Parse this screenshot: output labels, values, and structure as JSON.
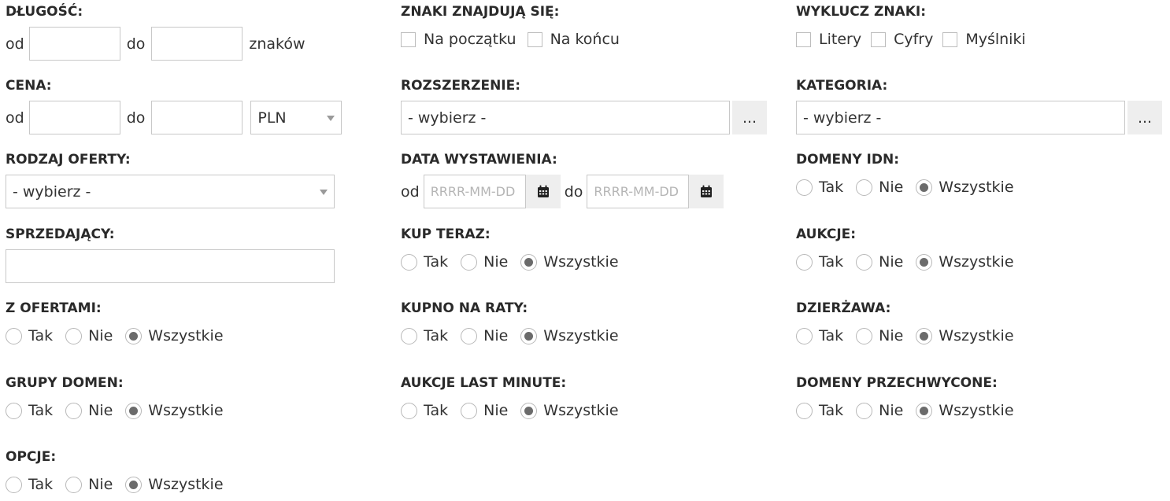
{
  "radio_options": {
    "yes": "Tak",
    "no": "Nie",
    "all": "Wszystkie"
  },
  "length": {
    "label": "DŁUGOŚĆ:",
    "from": "od",
    "to": "do",
    "unit": "znaków",
    "from_value": "",
    "to_value": ""
  },
  "chars_position": {
    "label": "ZNAKI ZNAJDUJĄ SIĘ:",
    "start": "Na początku",
    "end": "Na końcu"
  },
  "exclude_chars": {
    "label": "WYKLUCZ ZNAKI:",
    "letters": "Litery",
    "digits": "Cyfry",
    "hyphens": "Myślniki"
  },
  "price": {
    "label": "CENA:",
    "from": "od",
    "to": "do",
    "currency": "PLN"
  },
  "extension": {
    "label": "ROZSZERZENIE:",
    "value": "- wybierz -",
    "more": "..."
  },
  "category": {
    "label": "KATEGORIA:",
    "value": "- wybierz -",
    "more": "..."
  },
  "offer_type": {
    "label": "RODZAJ OFERTY:",
    "value": "- wybierz -"
  },
  "listing_date": {
    "label": "DATA WYSTAWIENIA:",
    "from": "od",
    "to": "do",
    "placeholder": "RRRR-MM-DD"
  },
  "idn_domains": {
    "label": "DOMENY IDN:",
    "selected": "Wszystkie"
  },
  "seller": {
    "label": "SPRZEDAJĄCY:",
    "value": ""
  },
  "buy_now": {
    "label": "KUP TERAZ:",
    "selected": "Wszystkie"
  },
  "auctions": {
    "label": "AUKCJE:",
    "selected": "Wszystkie"
  },
  "with_offers": {
    "label": "Z OFERTAMI:",
    "selected": "Wszystkie"
  },
  "installments": {
    "label": "KUPNO NA RATY:",
    "selected": "Wszystkie"
  },
  "lease": {
    "label": "DZIERŻAWA:",
    "selected": "Wszystkie"
  },
  "domain_groups": {
    "label": "GRUPY DOMEN:",
    "selected": "Wszystkie"
  },
  "last_minute": {
    "label": "AUKCJE LAST MINUTE:",
    "selected": "Wszystkie"
  },
  "intercepted_domains": {
    "label": "DOMENY PRZECHWYCONE:",
    "selected": "Wszystkie"
  },
  "options": {
    "label": "OPCJE:",
    "selected": "Wszystkie"
  }
}
